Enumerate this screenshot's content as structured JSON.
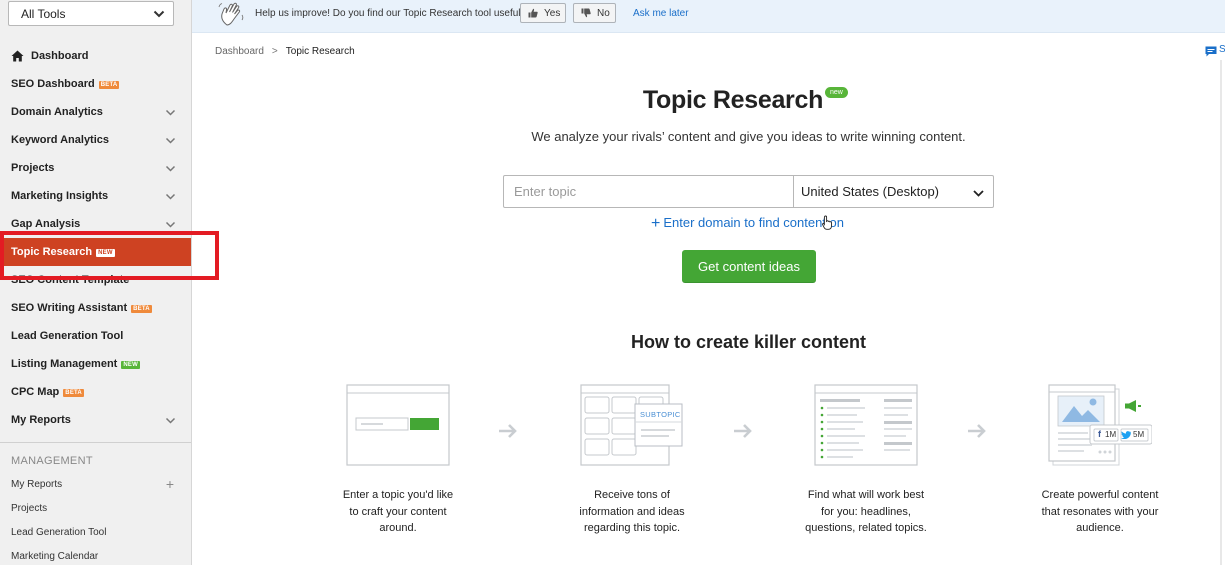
{
  "sidebar": {
    "tool_select": "All Tools",
    "nav": [
      {
        "label": "Dashboard",
        "badge": "",
        "chevron": false
      },
      {
        "label": "SEO Dashboard",
        "badge": "BETA",
        "chevron": false
      },
      {
        "label": "Domain Analytics",
        "badge": "",
        "chevron": true
      },
      {
        "label": "Keyword Analytics",
        "badge": "",
        "chevron": true
      },
      {
        "label": "Projects",
        "badge": "",
        "chevron": true
      },
      {
        "label": "Marketing Insights",
        "badge": "",
        "chevron": true
      },
      {
        "label": "Gap Analysis",
        "badge": "",
        "chevron": true
      },
      {
        "label": "Topic Research",
        "badge": "NEW",
        "chevron": false,
        "active": true
      },
      {
        "label": "SEO Content Template",
        "badge": "",
        "chevron": false
      },
      {
        "label": "SEO Writing Assistant",
        "badge": "BETA",
        "chevron": false
      },
      {
        "label": "Lead Generation Tool",
        "badge": "",
        "chevron": false
      },
      {
        "label": "Listing Management",
        "badge": "NEW",
        "chevron": false
      },
      {
        "label": "CPC Map",
        "badge": "BETA",
        "chevron": false
      },
      {
        "label": "My Reports",
        "badge": "",
        "chevron": true
      }
    ],
    "management_title": "MANAGEMENT",
    "management": [
      {
        "label": "My Reports",
        "plus": "+"
      },
      {
        "label": "Projects",
        "plus": ""
      },
      {
        "label": "Lead Generation Tool",
        "plus": ""
      },
      {
        "label": "Marketing Calendar",
        "plus": ""
      }
    ],
    "highlight_color": "#e31b23",
    "active_color": "#ce4222"
  },
  "feedback": {
    "question": "Help us improve! Do you find our Topic Research tool useful?",
    "yes": "Yes",
    "no": "No",
    "ask_later": "Ask me later"
  },
  "breadcrumb": {
    "root": "Dashboard",
    "separator": ">",
    "current": "Topic Research"
  },
  "corner_letter": "S",
  "main": {
    "title": "Topic Research",
    "title_badge": "new",
    "subtitle": "We analyze your rivals’ content and give you ideas to write winning content.",
    "topic_placeholder": "Enter topic",
    "country": "United States (Desktop)",
    "domain_link_plus": "+",
    "domain_link": "Enter domain to find content on",
    "cta": "Get content ideas",
    "cta_color": "#44a635"
  },
  "how": {
    "title": "How to create killer content",
    "subtopic_label": "SUBTOPIC",
    "share_counts": {
      "facebook": "1M",
      "twitter": "5M"
    },
    "steps": [
      {
        "text": [
          "Enter a topic you'd like",
          "to craft your content",
          "around."
        ]
      },
      {
        "text": [
          "Receive tons of",
          "information and ideas",
          "regarding this topic."
        ]
      },
      {
        "text": [
          "Find what will work best",
          "for you: headlines,",
          "questions, related topics."
        ]
      },
      {
        "text": [
          "Create powerful content",
          "that resonates with your",
          "audience."
        ]
      }
    ]
  }
}
